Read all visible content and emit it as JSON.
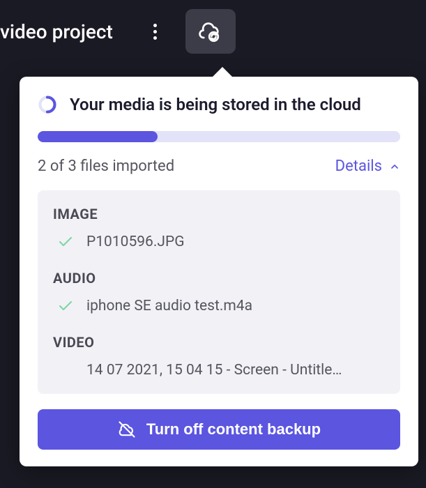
{
  "header": {
    "project_title": "video project"
  },
  "popover": {
    "status_text": "Your media is being stored in the cloud",
    "progress_percent": 33,
    "count_text": "2 of 3 files imported",
    "details_label": "Details",
    "sections": {
      "image": {
        "label": "IMAGE",
        "file": "P1010596.JPG",
        "done": true
      },
      "audio": {
        "label": "AUDIO",
        "file": "iphone SE audio test.m4a",
        "done": true
      },
      "video": {
        "label": "VIDEO",
        "file": "14 07 2021, 15 04 15 - Screen - Untitle…",
        "done": false
      }
    },
    "backup_button_label": "Turn off content backup"
  },
  "colors": {
    "accent": "#5b55e0"
  }
}
